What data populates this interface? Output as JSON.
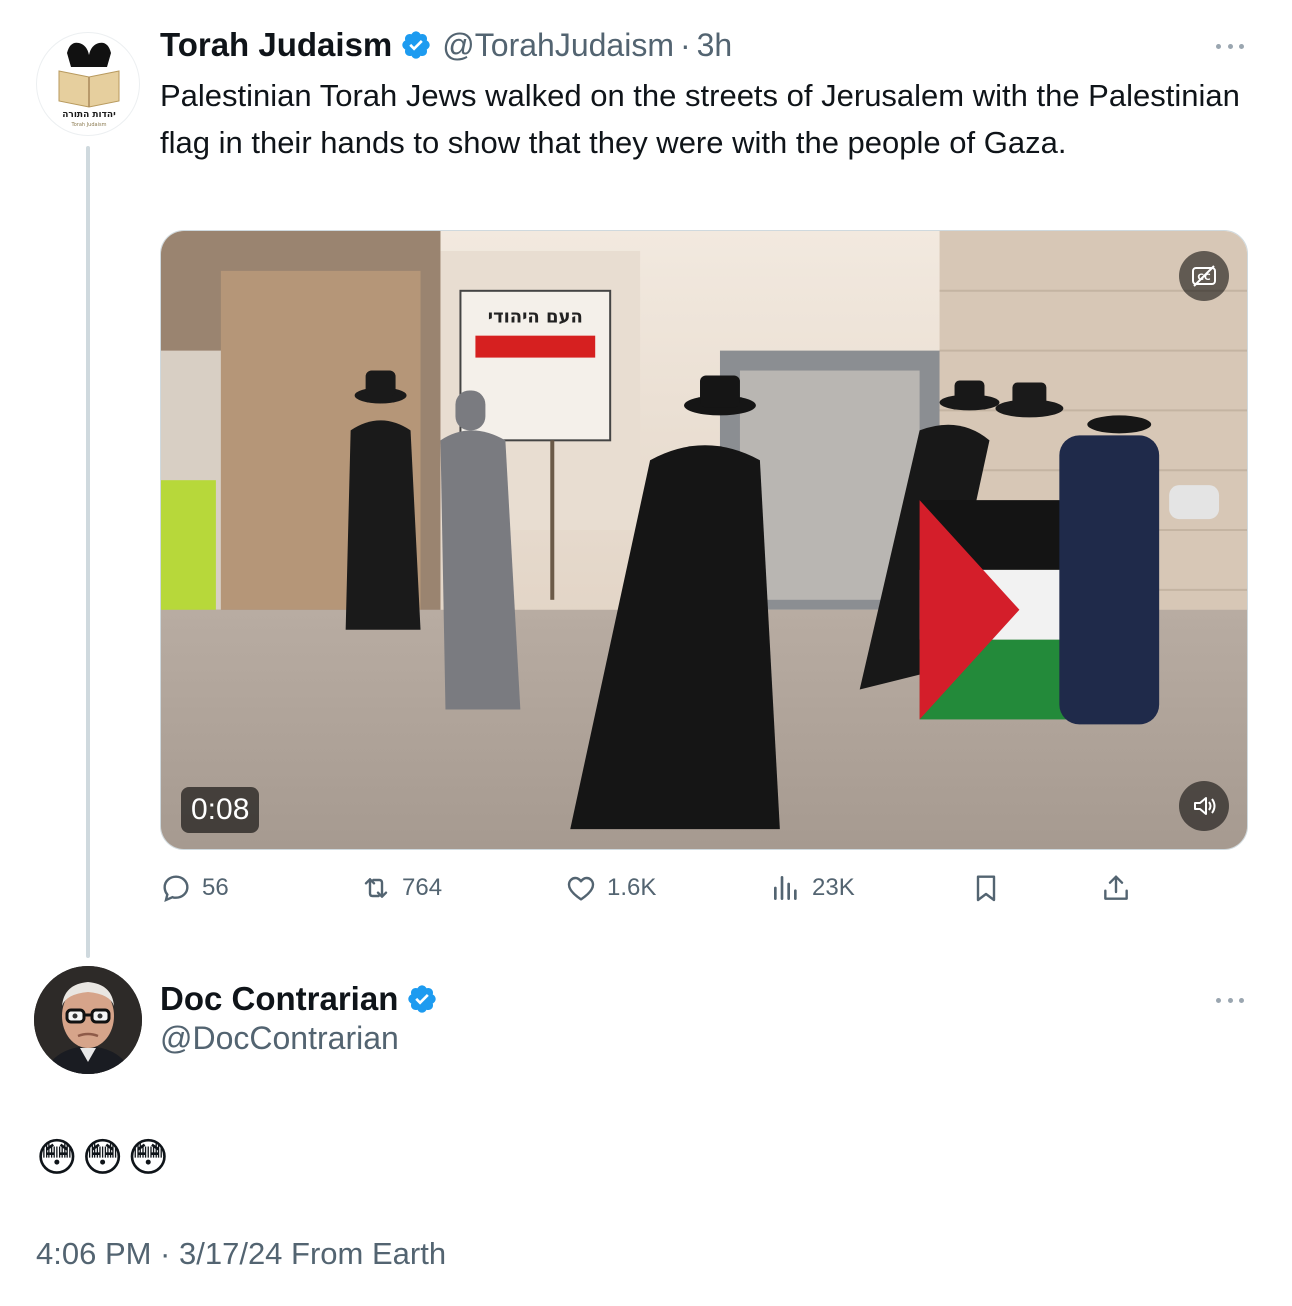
{
  "colors": {
    "text": "#0f1419",
    "secondary": "#536471",
    "verified": "#1d9bf0",
    "thread_line": "#cfd9de"
  },
  "tweet1": {
    "avatar": {
      "icon": "book-logo-icon",
      "logo_text": "יהדות התורה",
      "logo_subtext": "Torah Judaism"
    },
    "display_name": "Torah Judaism",
    "verified_icon": "verified-badge-icon",
    "handle": "@TorahJudaism",
    "separator": "·",
    "time": "3h",
    "more_icon": "more-options-icon",
    "text": "Palestinian Torah Jews walked on the streets of Jerusalem with the Palestinian flag in their hands to show that they were with the people of Gaza.",
    "media": {
      "type": "video",
      "duration": "0:08",
      "captions_icon": "captions-off-icon",
      "mute_icon": "volume-icon",
      "sign_text": "העם היהודי"
    },
    "actions": {
      "reply": {
        "icon": "reply-icon",
        "count": "56"
      },
      "retweet": {
        "icon": "retweet-icon",
        "count": "764"
      },
      "like": {
        "icon": "heart-icon",
        "count": "1.6K"
      },
      "views": {
        "icon": "views-icon",
        "count": "23K"
      },
      "bookmark": {
        "icon": "bookmark-icon"
      },
      "share": {
        "icon": "share-icon"
      }
    }
  },
  "tweet2": {
    "avatar": {
      "icon": "profile-photo-icon"
    },
    "display_name": "Doc Contrarian",
    "verified_icon": "verified-badge-icon",
    "handle": "@DocContrarian",
    "more_icon": "more-options-icon",
    "text": "😳😳😳",
    "meta": "4:06 PM · 3/17/24 From Earth"
  }
}
